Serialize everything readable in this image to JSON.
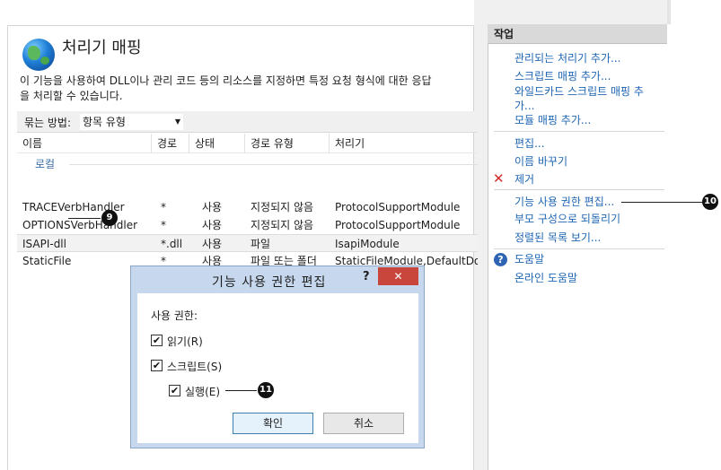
{
  "page": {
    "title": "처리기 매핑",
    "description_line1": "이 기능을 사용하여 DLL이나 관리 코드 등의 리소스를 지정하면 특정 요청 형식에 대한 응답",
    "description_line2": "을 처리할 수 있습니다."
  },
  "groupby": {
    "label": "묶는 방법:",
    "value": "항목 유형"
  },
  "table": {
    "columns": [
      "이름",
      "경로",
      "상태",
      "경로 유형",
      "처리기"
    ],
    "group": "로컬",
    "rows": [
      {
        "name": "TRACEVerbHandler",
        "path": "*",
        "state": "사용",
        "path_type": "지정되지 않음",
        "handler": "ProtocolSupportModule"
      },
      {
        "name": "OPTIONSVerbHandler",
        "path": "*",
        "state": "사용",
        "path_type": "지정되지 않음",
        "handler": "ProtocolSupportModule"
      },
      {
        "name": "ISAPI-dll",
        "path": "*.dll",
        "state": "사용",
        "path_type": "파일",
        "handler": "IsapiModule"
      },
      {
        "name": "StaticFile",
        "path": "*",
        "state": "사용",
        "path_type": "파일 또는 폴더",
        "handler": "StaticFileModule,DefaultDoc"
      }
    ]
  },
  "actions": {
    "header": "작업",
    "add_managed": "관리되는 처리기 추가...",
    "add_script": "스크립트 매핑 추가...",
    "add_wildcard_1": "와일드카드 스크립트 매핑 추",
    "add_wildcard_2": "가...",
    "add_module": "모듈 매핑 추가...",
    "edit": "편집...",
    "rename": "이름 바꾸기",
    "remove": "제거",
    "edit_permissions": "기능 사용 권한 편집...",
    "revert": "부모 구성으로 되돌리기",
    "view_ordered": "정렬된 목록 보기...",
    "help": "도움말",
    "online_help": "온라인 도움말"
  },
  "callouts": {
    "c9": "9",
    "c10": "10",
    "c11": "11"
  },
  "dialog": {
    "title": "기능 사용 권한 편집",
    "help": "?",
    "close": "✕",
    "perm_label": "사용 권한:",
    "read": "읽기(R)",
    "script": "스크립트(S)",
    "execute": "실행(E)",
    "ok": "확인",
    "cancel": "취소",
    "read_checked": true,
    "script_checked": true,
    "execute_checked": true
  },
  "icons": {
    "globe": "globe-icon",
    "remove": "remove-x-icon",
    "help": "help-icon",
    "check": "check-icon"
  },
  "colors": {
    "link": "#1f66b3",
    "dialog_frame": "#c7d8ee",
    "close": "#c9463d",
    "remove": "#d42a2a"
  }
}
